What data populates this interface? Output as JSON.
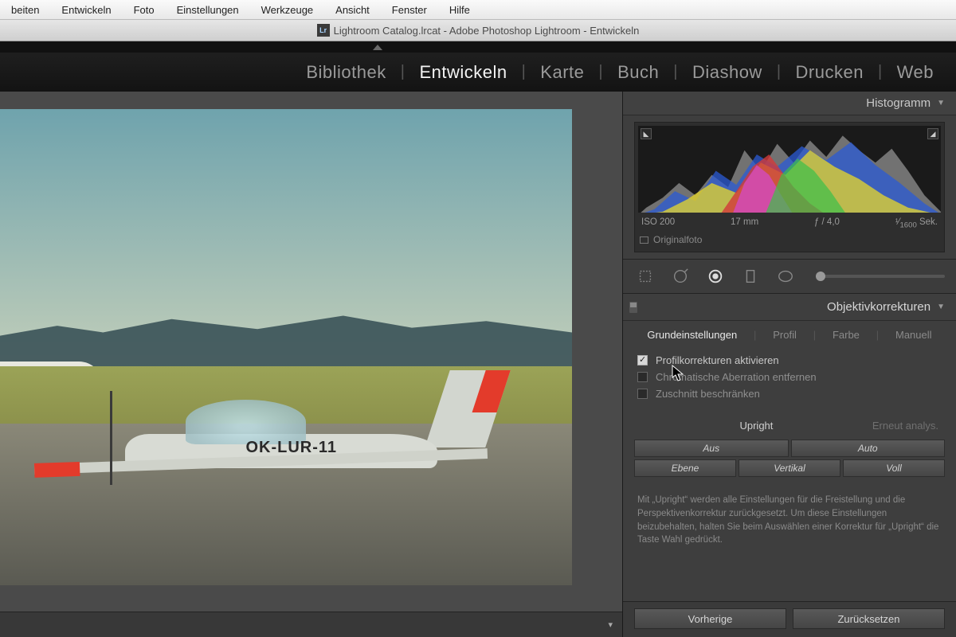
{
  "os_menu": [
    "beiten",
    "Entwickeln",
    "Foto",
    "Einstellungen",
    "Werkzeuge",
    "Ansicht",
    "Fenster",
    "Hilfe"
  ],
  "window_title": "Lightroom Catalog.lrcat - Adobe Photoshop Lightroom - Entwickeln",
  "modules": {
    "items": [
      "Bibliothek",
      "Entwickeln",
      "Karte",
      "Buch",
      "Diashow",
      "Drucken",
      "Web"
    ],
    "active": "Entwickeln"
  },
  "histogram": {
    "title": "Histogramm",
    "iso": "ISO 200",
    "focal": "17 mm",
    "aperture": "ƒ / 4,0",
    "shutter_pre": "¹⁄",
    "shutter_val": "1600",
    "shutter_suf": " Sek.",
    "original": "Originalfoto"
  },
  "lens": {
    "title": "Objektivkorrekturen",
    "tabs": [
      "Grundeinstellungen",
      "Profil",
      "Farbe",
      "Manuell"
    ],
    "active_tab": "Grundeinstellungen",
    "check_profile": "Profilkorrekturen aktivieren",
    "check_ca": "Chromatische Aberration entfernen",
    "check_crop": "Zuschnitt beschränken",
    "upright_label": "Upright",
    "reanalyze": "Erneut analys.",
    "btn_off": "Aus",
    "btn_auto": "Auto",
    "btn_level": "Ebene",
    "btn_vertical": "Vertikal",
    "btn_full": "Voll",
    "info": "Mit „Upright“ werden alle Einstellungen für die Freistellung und die Perspektivenkorrektur zurückgesetzt. Um diese Einstellungen beizubehalten, halten Sie beim Auswählen einer Korrektur für „Upright“ die Taste Wahl gedrückt."
  },
  "footer": {
    "previous": "Vorherige",
    "reset": "Zurücksetzen"
  },
  "photo": {
    "registration": "OK-LUR-11"
  }
}
